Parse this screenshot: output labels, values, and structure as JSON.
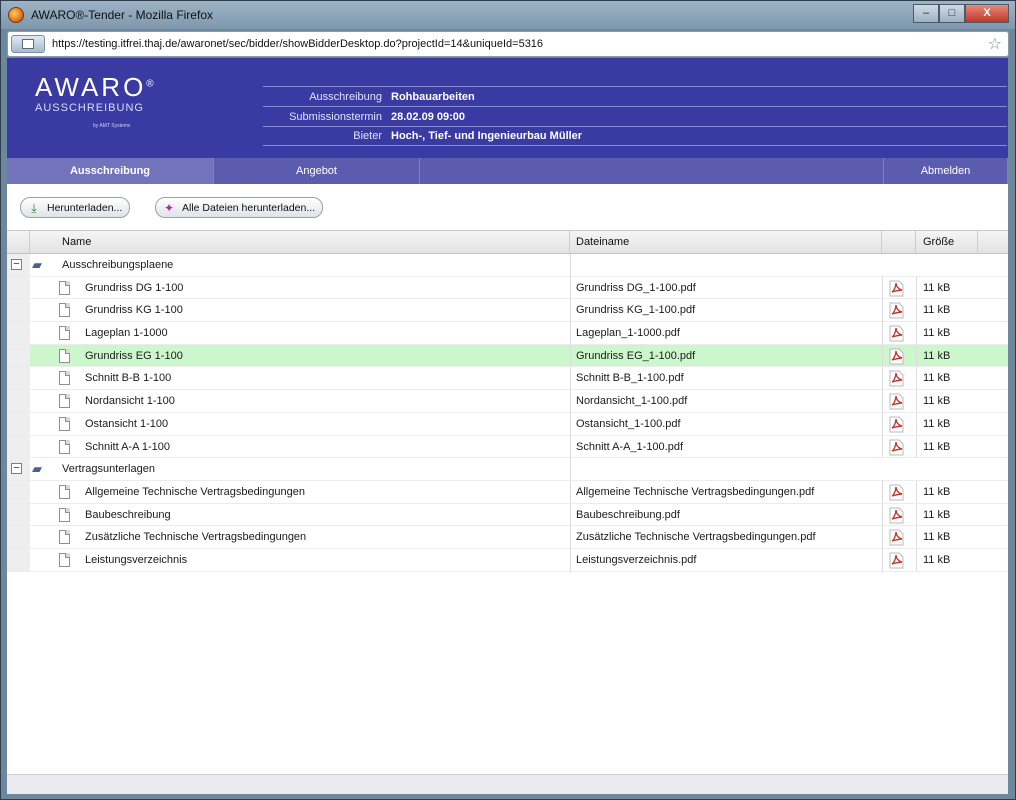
{
  "window": {
    "title": "AWARO®-Tender - Mozilla Firefox",
    "url": "https://testing.itfrei.thaj.de/awaronet/sec/bidder/showBidderDesktop.do?projectId=14&uniqueId=5316",
    "buttons": {
      "minimize": "–",
      "maximize": "□",
      "close": "X"
    }
  },
  "logo": {
    "main": "AWARO",
    "reg": "®",
    "sub": "AUSSCHREIBUNG",
    "by": "by AMT Systems"
  },
  "info": [
    {
      "label": "Ausschreibung",
      "value": "Rohbauarbeiten"
    },
    {
      "label": "Submissionstermin",
      "value": "28.02.09 09:00"
    },
    {
      "label": "Bieter",
      "value": "Hoch-, Tief- und Ingenieurbau Müller"
    }
  ],
  "nav": {
    "tab1": "Ausschreibung",
    "tab2": "Angebot",
    "logout": "Abmelden"
  },
  "toolbar": {
    "download": "Herunterladen...",
    "download_all": "Alle Dateien herunterladen..."
  },
  "table": {
    "headers": {
      "name": "Name",
      "filename": "Dateiname",
      "size": "Größe"
    },
    "groups": [
      {
        "name": "Ausschreibungsplaene",
        "toggle": "⊟",
        "items": [
          {
            "name": "Grundriss DG 1-100",
            "file": "Grundriss DG_1-100.pdf",
            "size": "11 kB"
          },
          {
            "name": "Grundriss KG 1-100",
            "file": "Grundriss KG_1-100.pdf",
            "size": "11 kB"
          },
          {
            "name": "Lageplan 1-1000",
            "file": "Lageplan_1-1000.pdf",
            "size": "11 kB"
          },
          {
            "name": "Grundriss EG 1-100",
            "file": "Grundriss EG_1-100.pdf",
            "size": "11 kB",
            "selected": true
          },
          {
            "name": "Schnitt B-B 1-100",
            "file": "Schnitt B-B_1-100.pdf",
            "size": "11 kB"
          },
          {
            "name": "Nordansicht 1-100",
            "file": "Nordansicht_1-100.pdf",
            "size": "11 kB"
          },
          {
            "name": "Ostansicht 1-100",
            "file": "Ostansicht_1-100.pdf",
            "size": "11 kB"
          },
          {
            "name": "Schnitt A-A 1-100",
            "file": "Schnitt A-A_1-100.pdf",
            "size": "11 kB"
          }
        ]
      },
      {
        "name": "Vertragsunterlagen",
        "toggle": "⊟",
        "items": [
          {
            "name": "Allgemeine Technische Vertragsbedingungen",
            "file": "Allgemeine Technische Vertragsbedingungen.pdf",
            "size": "11 kB"
          },
          {
            "name": "Baubeschreibung",
            "file": "Baubeschreibung.pdf",
            "size": "11 kB"
          },
          {
            "name": "Zusätzliche Technische Vertragsbedingungen",
            "file": "Zusätzliche Technische Vertragsbedingungen.pdf",
            "size": "11 kB"
          },
          {
            "name": "Leistungsverzeichnis",
            "file": "Leistungsverzeichnis.pdf",
            "size": "11 kB"
          }
        ]
      }
    ]
  },
  "colors": {
    "brand": "#3a3aa3",
    "nav": "#5c5caf",
    "selected_row": "#ccf7cc",
    "pdf": "#c0392b"
  }
}
